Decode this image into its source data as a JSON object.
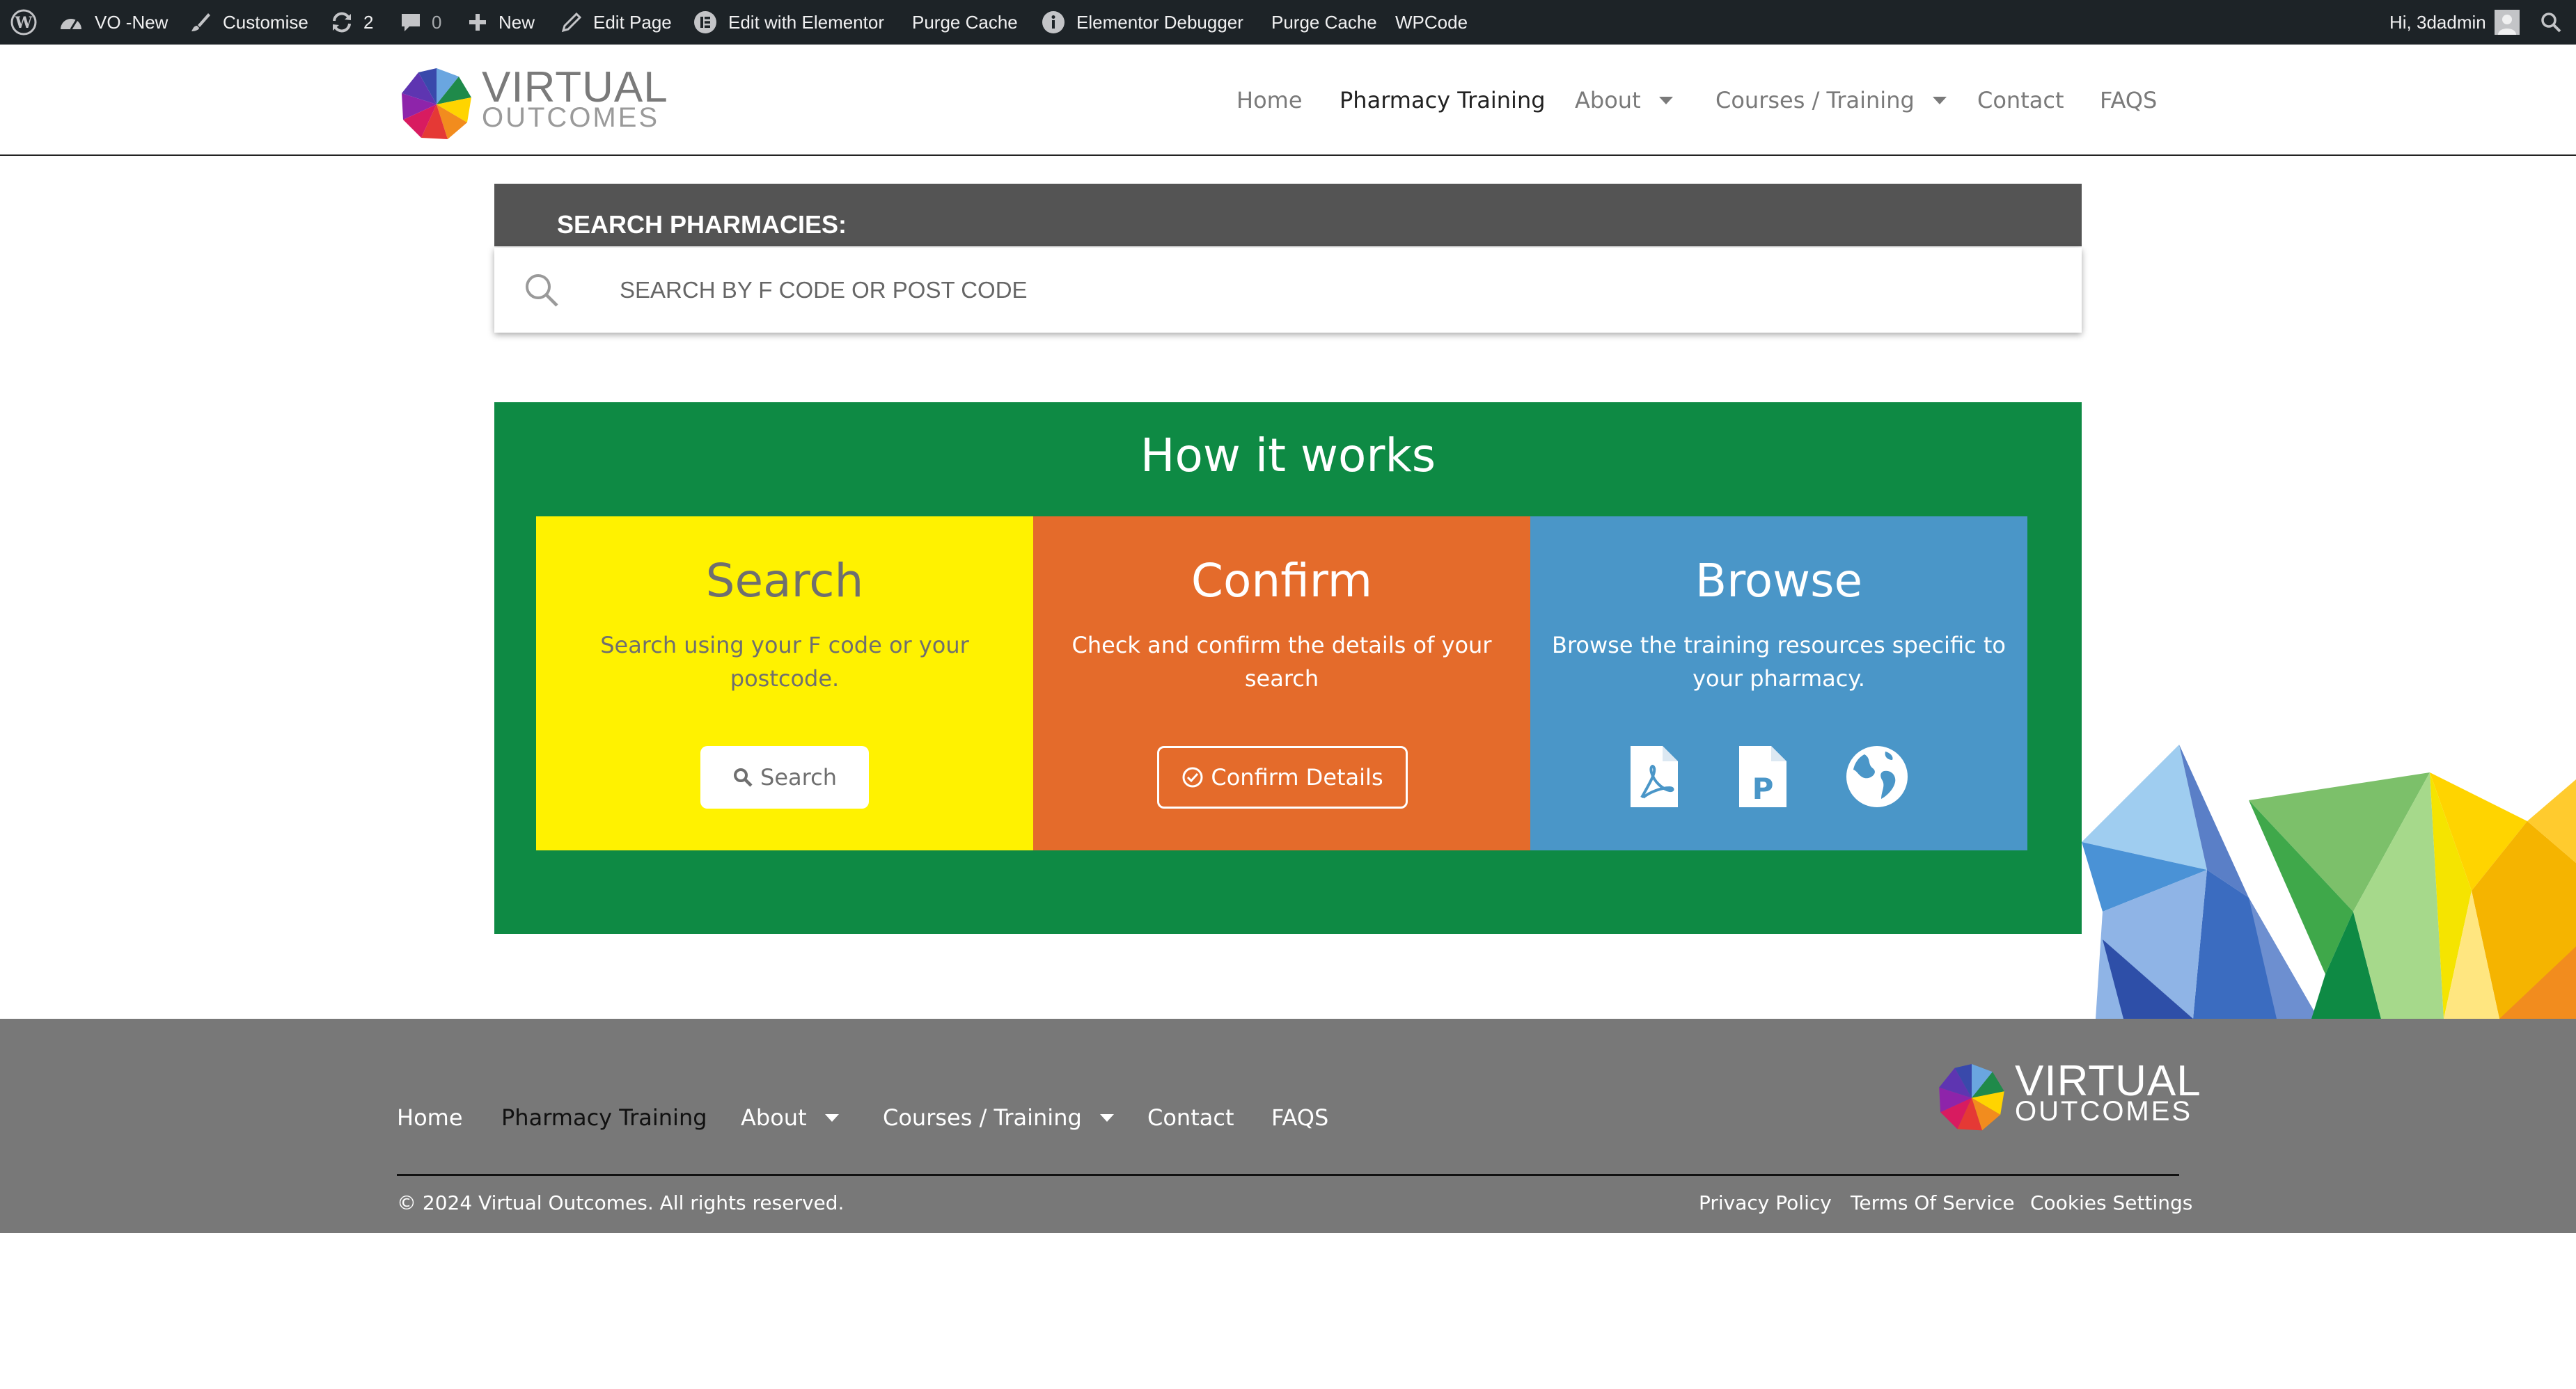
{
  "adminbar": {
    "site_name": "VO -New",
    "customise": "Customise",
    "updates_count": "2",
    "comments_count": "0",
    "new": "New",
    "edit_page": "Edit Page",
    "edit_elementor": "Edit with Elementor",
    "purge_cache_1": "Purge Cache",
    "elementor_debugger": "Elementor Debugger",
    "purge_cache_2": "Purge Cache",
    "wpcode": "WPCode",
    "greeting": "Hi, 3dadmin"
  },
  "logo": {
    "line1": "VIRTUAL",
    "line2": "OUTCOMES"
  },
  "nav": {
    "home": "Home",
    "pharmacy_training": "Pharmacy Training",
    "about": "About",
    "courses": "Courses / Training",
    "contact": "Contact",
    "faqs": "FAQS"
  },
  "search": {
    "title": "SEARCH PHARMACIES:",
    "placeholder": "SEARCH BY F CODE OR POST CODE"
  },
  "how": {
    "title": "How it works",
    "cards": [
      {
        "title": "Search",
        "text": "Search using your F code or your postcode.",
        "button": "Search"
      },
      {
        "title": "Confirm",
        "text": "Check and confirm the details of your search",
        "button": "Confirm Details"
      },
      {
        "title": "Browse",
        "text": "Browse the training resources specific to your pharmacy.",
        "icons": [
          "pdf-icon",
          "powerpoint-icon",
          "globe-icon"
        ]
      }
    ]
  },
  "footer": {
    "nav": {
      "home": "Home",
      "pharmacy_training": "Pharmacy Training",
      "about": "About",
      "courses": "Courses / Training",
      "contact": "Contact",
      "faqs": "FAQS"
    },
    "copyright": "© 2024 Virtual Outcomes. All rights reserved.",
    "privacy": "Privacy Policy",
    "terms": "Terms Of Service",
    "cookies": "Cookies Settings"
  },
  "colors": {
    "adminbar": "#1d2327",
    "search_header": "#545454",
    "how_bg": "#0e8a44",
    "card_search": "#fff200",
    "card_confirm": "#e46b2b",
    "card_browse": "#4a96c8",
    "footer_bg": "#787878"
  }
}
